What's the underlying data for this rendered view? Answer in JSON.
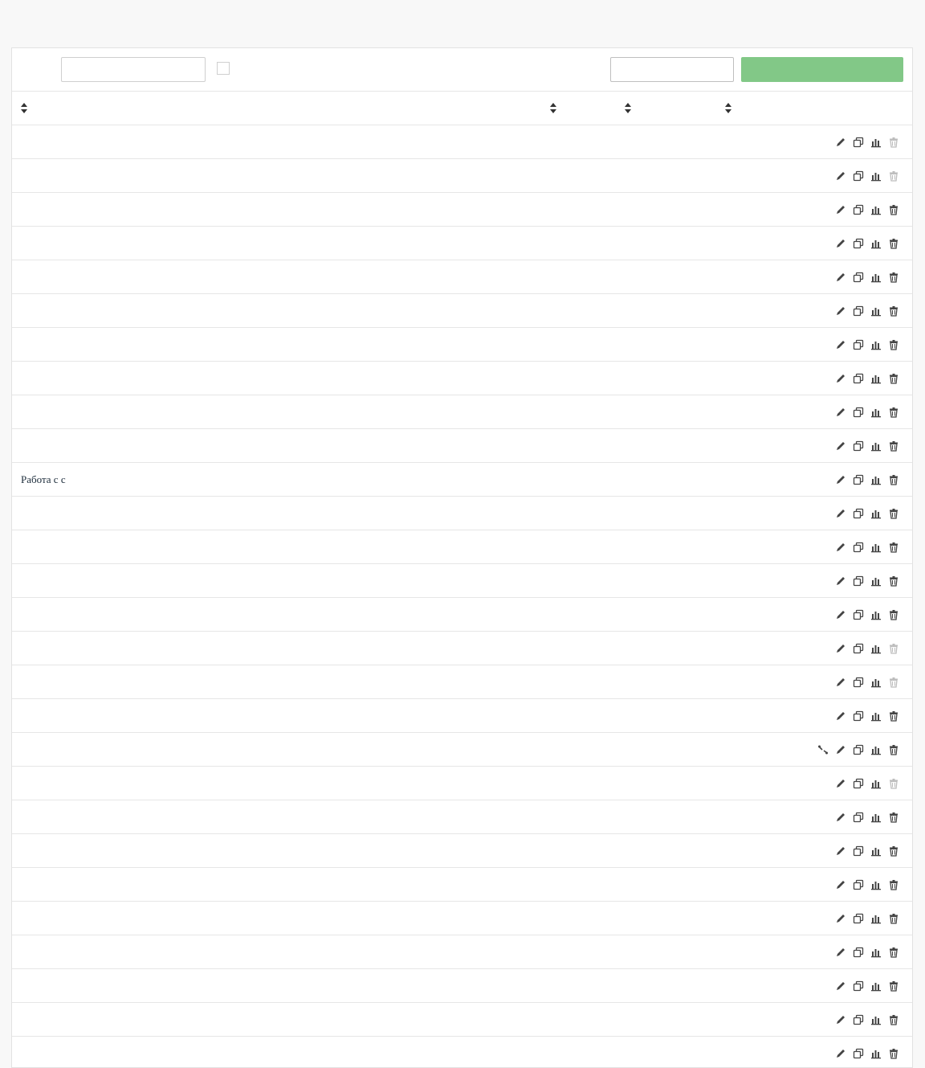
{
  "page": {
    "title_part1": "",
    "title_part2": ""
  },
  "toolbar": {
    "filter_label": "",
    "search_placeholder": "",
    "search_value": "",
    "checkbox_label": "",
    "checkbox_checked": false,
    "secondary_button_label": "",
    "primary_button_label": ""
  },
  "colors": {
    "primary_button": "#82c887",
    "title": "#17304a"
  },
  "table": {
    "headers": {
      "name": "",
      "col_a": "",
      "col_b": "",
      "col_c": ""
    },
    "rows": [
      {
        "name": "",
        "a": "",
        "b": "",
        "c": "",
        "has_link_icon": false,
        "delete_disabled": true
      },
      {
        "name": "",
        "a": "",
        "b": "",
        "c": "",
        "has_link_icon": false,
        "delete_disabled": true
      },
      {
        "name": "",
        "a": "",
        "b": "",
        "c": "",
        "has_link_icon": false,
        "delete_disabled": false
      },
      {
        "name": "",
        "a": "",
        "b": "",
        "c": "",
        "has_link_icon": false,
        "delete_disabled": false
      },
      {
        "name": "",
        "a": "",
        "b": "",
        "c": "",
        "has_link_icon": false,
        "delete_disabled": false
      },
      {
        "name": "",
        "a": "",
        "b": "",
        "c": "",
        "has_link_icon": false,
        "delete_disabled": false
      },
      {
        "name": "",
        "a": "",
        "b": "",
        "c": "",
        "has_link_icon": false,
        "delete_disabled": false
      },
      {
        "name": "",
        "a": "",
        "b": "",
        "c": "",
        "has_link_icon": false,
        "delete_disabled": false
      },
      {
        "name": "",
        "a": "",
        "b": "",
        "c": "",
        "has_link_icon": false,
        "delete_disabled": false
      },
      {
        "name": "",
        "a": "",
        "b": "",
        "c": "",
        "has_link_icon": false,
        "delete_disabled": false
      },
      {
        "name": "Работа с с",
        "a": "",
        "b": "",
        "c": "",
        "has_link_icon": false,
        "delete_disabled": false
      },
      {
        "name": "",
        "a": "",
        "b": "",
        "c": "",
        "has_link_icon": false,
        "delete_disabled": false
      },
      {
        "name": "",
        "a": "",
        "b": "",
        "c": "",
        "has_link_icon": false,
        "delete_disabled": false
      },
      {
        "name": "",
        "a": "",
        "b": "",
        "c": "",
        "has_link_icon": false,
        "delete_disabled": false
      },
      {
        "name": "",
        "a": "",
        "b": "",
        "c": "",
        "has_link_icon": false,
        "delete_disabled": false
      },
      {
        "name": "",
        "a": "",
        "b": "",
        "c": "",
        "has_link_icon": false,
        "delete_disabled": true
      },
      {
        "name": "",
        "a": "",
        "b": "",
        "c": "",
        "has_link_icon": false,
        "delete_disabled": true
      },
      {
        "name": "",
        "a": "",
        "b": "",
        "c": "",
        "has_link_icon": false,
        "delete_disabled": false
      },
      {
        "name": "",
        "a": "",
        "b": "",
        "c": "",
        "has_link_icon": true,
        "delete_disabled": false
      },
      {
        "name": "",
        "a": "",
        "b": "",
        "c": "",
        "has_link_icon": false,
        "delete_disabled": true
      },
      {
        "name": "",
        "a": "",
        "b": "",
        "c": "",
        "has_link_icon": false,
        "delete_disabled": false
      },
      {
        "name": "",
        "a": "",
        "b": "",
        "c": "",
        "has_link_icon": false,
        "delete_disabled": false
      },
      {
        "name": "",
        "a": "",
        "b": "",
        "c": "",
        "has_link_icon": false,
        "delete_disabled": false
      },
      {
        "name": "",
        "a": "",
        "b": "",
        "c": "",
        "has_link_icon": false,
        "delete_disabled": false
      },
      {
        "name": "",
        "a": "",
        "b": "",
        "c": "",
        "has_link_icon": false,
        "delete_disabled": false
      },
      {
        "name": "",
        "a": "",
        "b": "",
        "c": "",
        "has_link_icon": false,
        "delete_disabled": false
      },
      {
        "name": "",
        "a": "",
        "b": "",
        "c": "",
        "has_link_icon": false,
        "delete_disabled": false
      },
      {
        "name": "",
        "a": "",
        "b": "",
        "c": "",
        "has_link_icon": false,
        "delete_disabled": false
      }
    ],
    "row_actions": [
      "link-icon",
      "pencil-icon",
      "copy-icon",
      "bar-chart-icon",
      "trash-icon"
    ]
  }
}
